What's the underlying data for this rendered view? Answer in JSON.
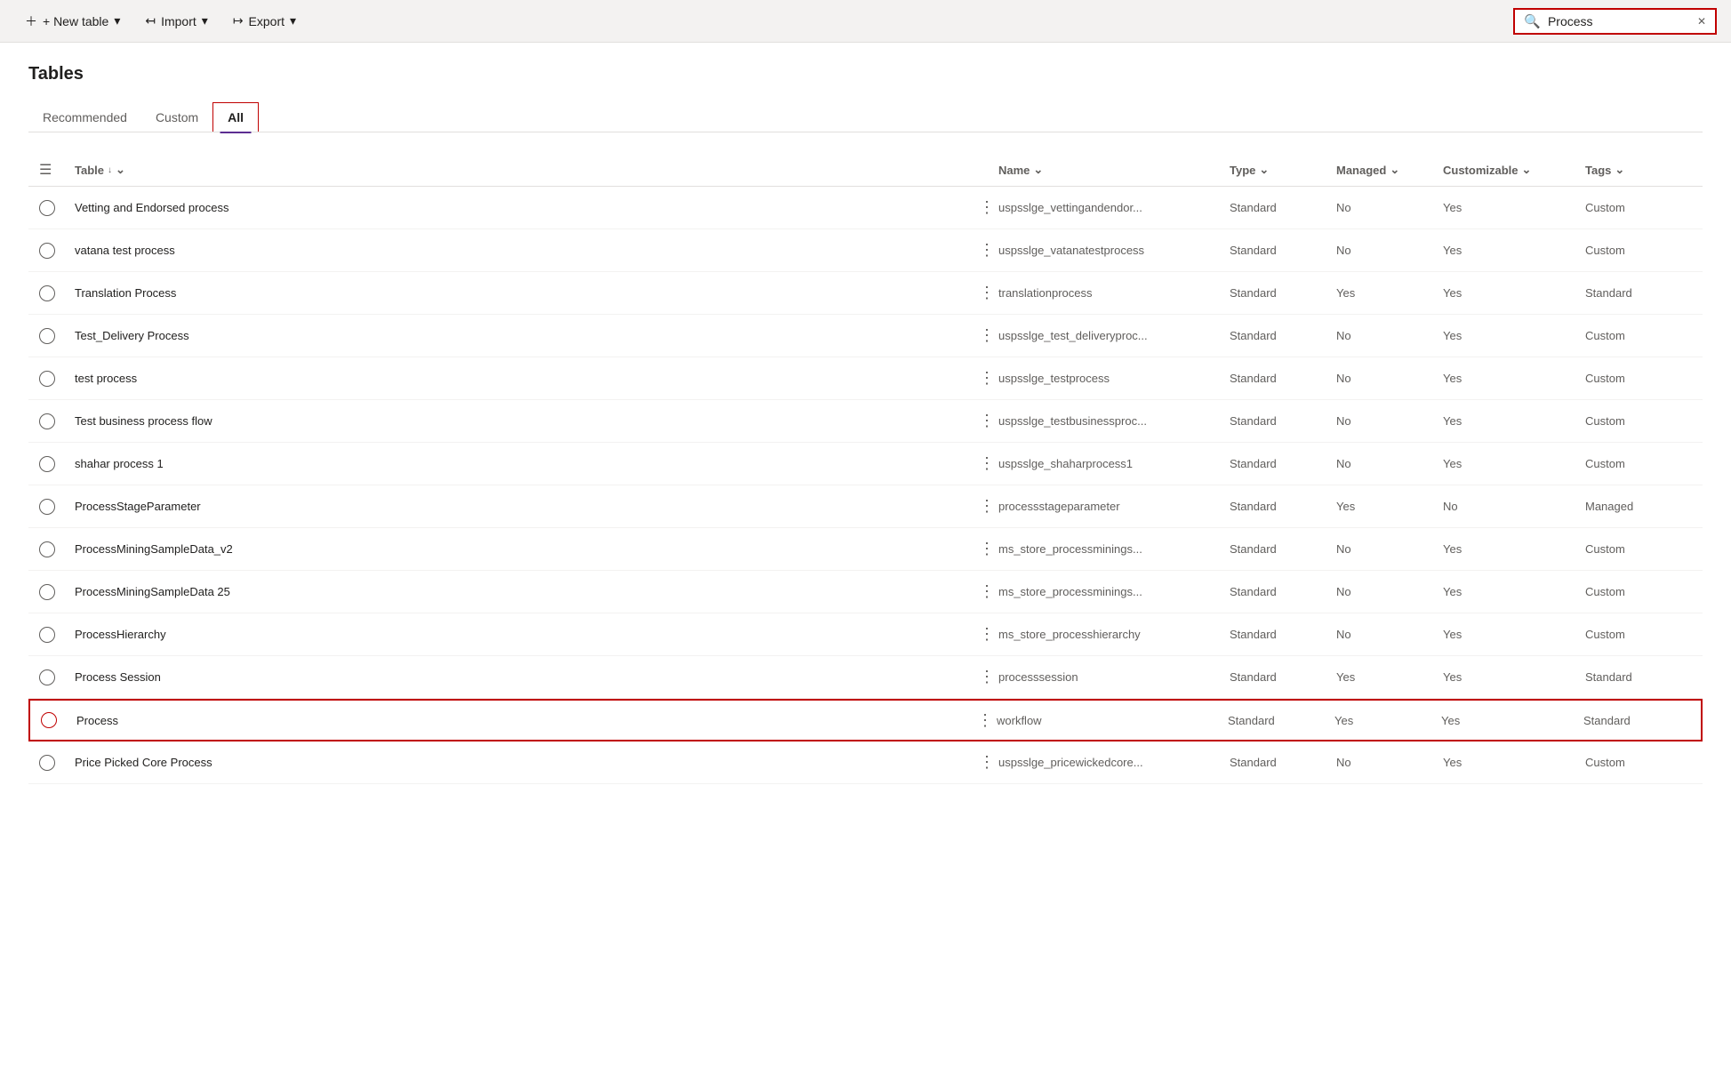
{
  "toolbar": {
    "new_table_label": "+ New table",
    "import_label": "Import",
    "export_label": "Export",
    "new_table_chevron": "▾",
    "import_chevron": "▾",
    "export_chevron": "▾"
  },
  "search": {
    "value": "Process",
    "placeholder": "Search"
  },
  "page": {
    "title": "Tables"
  },
  "tabs": [
    {
      "id": "recommended",
      "label": "Recommended",
      "active": false
    },
    {
      "id": "custom",
      "label": "Custom",
      "active": false
    },
    {
      "id": "all",
      "label": "All",
      "active": true
    }
  ],
  "table": {
    "columns": [
      {
        "id": "select",
        "label": ""
      },
      {
        "id": "table",
        "label": "Table",
        "sort": "↓",
        "chevron": "⌄"
      },
      {
        "id": "more",
        "label": ""
      },
      {
        "id": "name",
        "label": "Name",
        "chevron": "⌄"
      },
      {
        "id": "type",
        "label": "Type",
        "chevron": "⌄"
      },
      {
        "id": "managed",
        "label": "Managed",
        "chevron": "⌄"
      },
      {
        "id": "customizable",
        "label": "Customizable",
        "chevron": "⌄"
      },
      {
        "id": "tags",
        "label": "Tags",
        "chevron": "⌄"
      }
    ],
    "rows": [
      {
        "id": 1,
        "table": "Vetting and Endorsed process",
        "name": "uspsslge_vettingandendor...",
        "type": "Standard",
        "managed": "No",
        "customizable": "Yes",
        "tags": "Custom",
        "selected": false
      },
      {
        "id": 2,
        "table": "vatana test process",
        "name": "uspsslge_vatanatestprocess",
        "type": "Standard",
        "managed": "No",
        "customizable": "Yes",
        "tags": "Custom",
        "selected": false
      },
      {
        "id": 3,
        "table": "Translation Process",
        "name": "translationprocess",
        "type": "Standard",
        "managed": "Yes",
        "customizable": "Yes",
        "tags": "Standard",
        "selected": false
      },
      {
        "id": 4,
        "table": "Test_Delivery Process",
        "name": "uspsslge_test_deliveryproc...",
        "type": "Standard",
        "managed": "No",
        "customizable": "Yes",
        "tags": "Custom",
        "selected": false
      },
      {
        "id": 5,
        "table": "test process",
        "name": "uspsslge_testprocess",
        "type": "Standard",
        "managed": "No",
        "customizable": "Yes",
        "tags": "Custom",
        "selected": false
      },
      {
        "id": 6,
        "table": "Test business process flow",
        "name": "uspsslge_testbusinessproc...",
        "type": "Standard",
        "managed": "No",
        "customizable": "Yes",
        "tags": "Custom",
        "selected": false
      },
      {
        "id": 7,
        "table": "shahar process 1",
        "name": "uspsslge_shaharprocess1",
        "type": "Standard",
        "managed": "No",
        "customizable": "Yes",
        "tags": "Custom",
        "selected": false
      },
      {
        "id": 8,
        "table": "ProcessStageParameter",
        "name": "processstageparameter",
        "type": "Standard",
        "managed": "Yes",
        "customizable": "No",
        "tags": "Managed",
        "selected": false
      },
      {
        "id": 9,
        "table": "ProcessMiningSampleData_v2",
        "name": "ms_store_processminings...",
        "type": "Standard",
        "managed": "No",
        "customizable": "Yes",
        "tags": "Custom",
        "selected": false
      },
      {
        "id": 10,
        "table": "ProcessMiningSampleData 25",
        "name": "ms_store_processminings...",
        "type": "Standard",
        "managed": "No",
        "customizable": "Yes",
        "tags": "Custom",
        "selected": false
      },
      {
        "id": 11,
        "table": "ProcessHierarchy",
        "name": "ms_store_processhierarchy",
        "type": "Standard",
        "managed": "No",
        "customizable": "Yes",
        "tags": "Custom",
        "selected": false
      },
      {
        "id": 12,
        "table": "Process Session",
        "name": "processsession",
        "type": "Standard",
        "managed": "Yes",
        "customizable": "Yes",
        "tags": "Standard",
        "selected": false
      },
      {
        "id": 13,
        "table": "Process",
        "name": "workflow",
        "type": "Standard",
        "managed": "Yes",
        "customizable": "Yes",
        "tags": "Standard",
        "selected": true
      },
      {
        "id": 14,
        "table": "Price Picked Core Process",
        "name": "uspsslge_pricewickedcore...",
        "type": "Standard",
        "managed": "No",
        "customizable": "Yes",
        "tags": "Custom",
        "selected": false
      }
    ]
  }
}
